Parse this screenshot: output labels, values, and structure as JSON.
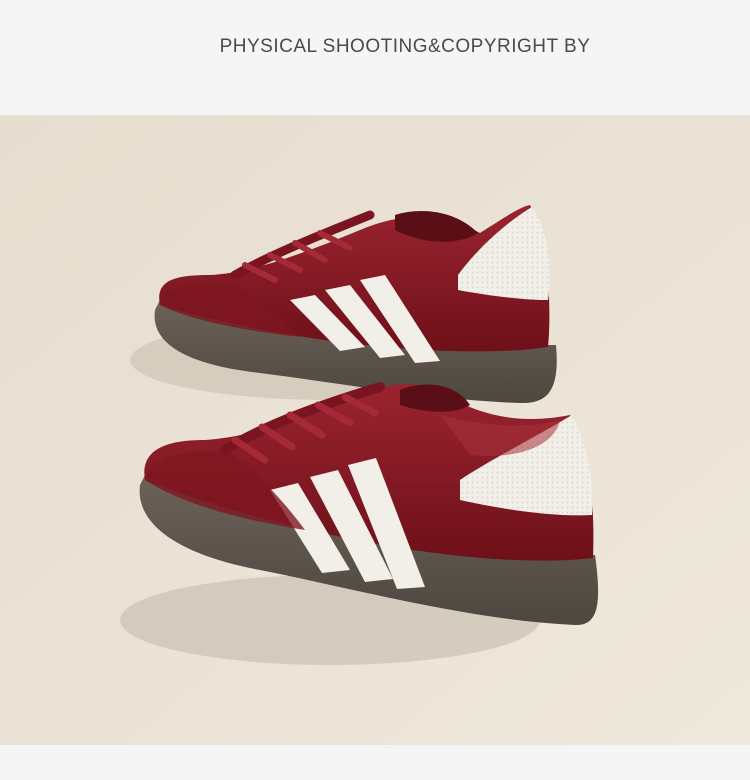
{
  "header": {
    "text": "PHYSICAL SHOOTING&COPYRIGHT BY"
  },
  "photo": {
    "subject": "pair-of-burgundy-suede-sneakers",
    "colors": {
      "background": "#eae2d6",
      "suede": "#8a1b26",
      "suede_dark": "#6e1019",
      "stripes": "#f2efe8",
      "sole": "#5f574e"
    }
  }
}
